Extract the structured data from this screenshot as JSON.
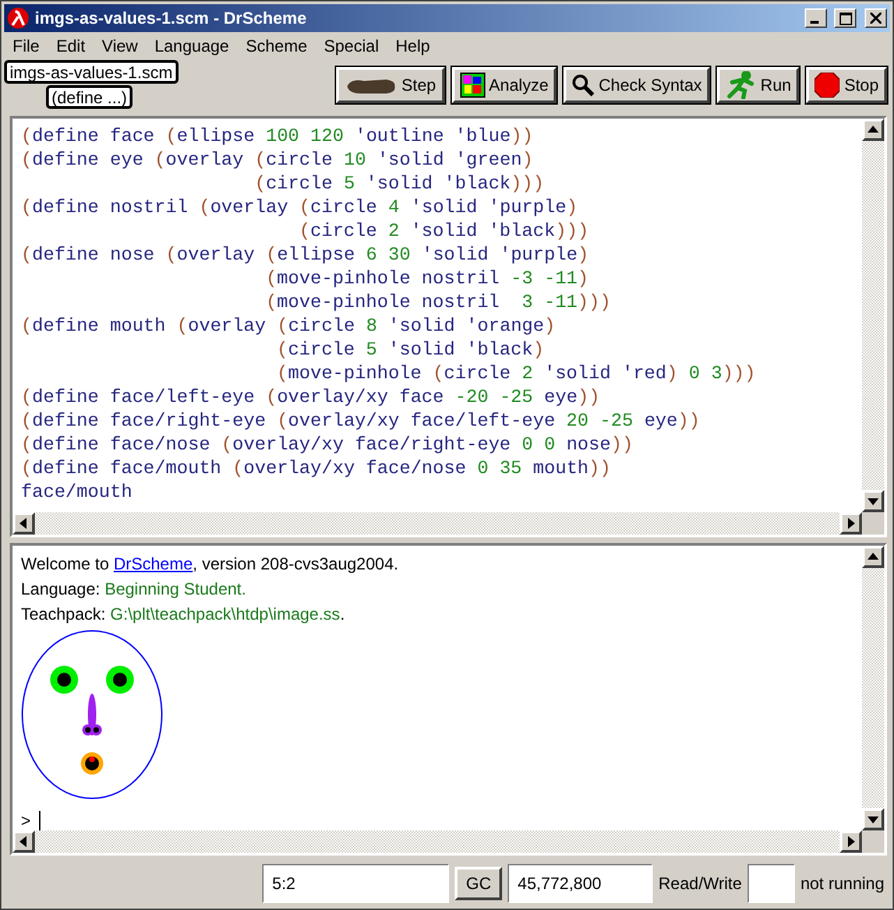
{
  "window": {
    "title": "imgs-as-values-1.scm - DrScheme"
  },
  "menu": [
    "File",
    "Edit",
    "View",
    "Language",
    "Scheme",
    "Special",
    "Help"
  ],
  "toolbar": {
    "file_button": "imgs-as-values-1.scm",
    "define_button": "(define ...)",
    "buttons": [
      {
        "kind": "step",
        "label": "Step"
      },
      {
        "kind": "analyze",
        "label": "Analyze"
      },
      {
        "kind": "check",
        "label": "Check Syntax"
      },
      {
        "kind": "run",
        "label": "Run"
      },
      {
        "kind": "stop",
        "label": "Stop"
      }
    ]
  },
  "editor": {
    "lines": [
      "(define face (ellipse 100 120 'outline 'blue))",
      "(define eye (overlay (circle 10 'solid 'green)",
      "                     (circle 5 'solid 'black)))",
      "(define nostril (overlay (circle 4 'solid 'purple)",
      "                         (circle 2 'solid 'black)))",
      "(define nose (overlay (ellipse 6 30 'solid 'purple)",
      "                      (move-pinhole nostril -3 -11)",
      "                      (move-pinhole nostril  3 -11)))",
      "(define mouth (overlay (circle 8 'solid 'orange)",
      "                       (circle 5 'solid 'black)",
      "                       (move-pinhole (circle 2 'solid 'red) 0 3)))",
      "(define face/left-eye (overlay/xy face -20 -25 eye))",
      "(define face/right-eye (overlay/xy face/left-eye 20 -25 eye))",
      "(define face/nose (overlay/xy face/right-eye 0 0 nose))",
      "(define face/mouth (overlay/xy face/nose 0 35 mouth))",
      "face/mouth"
    ]
  },
  "interactions": {
    "lines": [
      [
        {
          "kind": "text",
          "text": "Welcome to "
        },
        {
          "kind": "link",
          "text": "DrScheme"
        },
        {
          "kind": "text",
          "text": ", version 208-cvs3aug2004."
        }
      ],
      [
        {
          "kind": "text",
          "text": "Language: "
        },
        {
          "kind": "value",
          "text": "Beginning Student."
        }
      ],
      [
        {
          "kind": "text",
          "text": "Teachpack: "
        },
        {
          "kind": "value",
          "text": "G:\\plt\\teachpack\\htdp\\image.ss"
        },
        {
          "kind": "text",
          "text": "."
        }
      ]
    ],
    "output": {
      "kind": "picture"
    },
    "prompt": ">"
  },
  "status_bar": {
    "position": "5:2",
    "gc_button": "GC",
    "memory": "45,772,800",
    "mode": "Read/Write",
    "state": "not running"
  }
}
